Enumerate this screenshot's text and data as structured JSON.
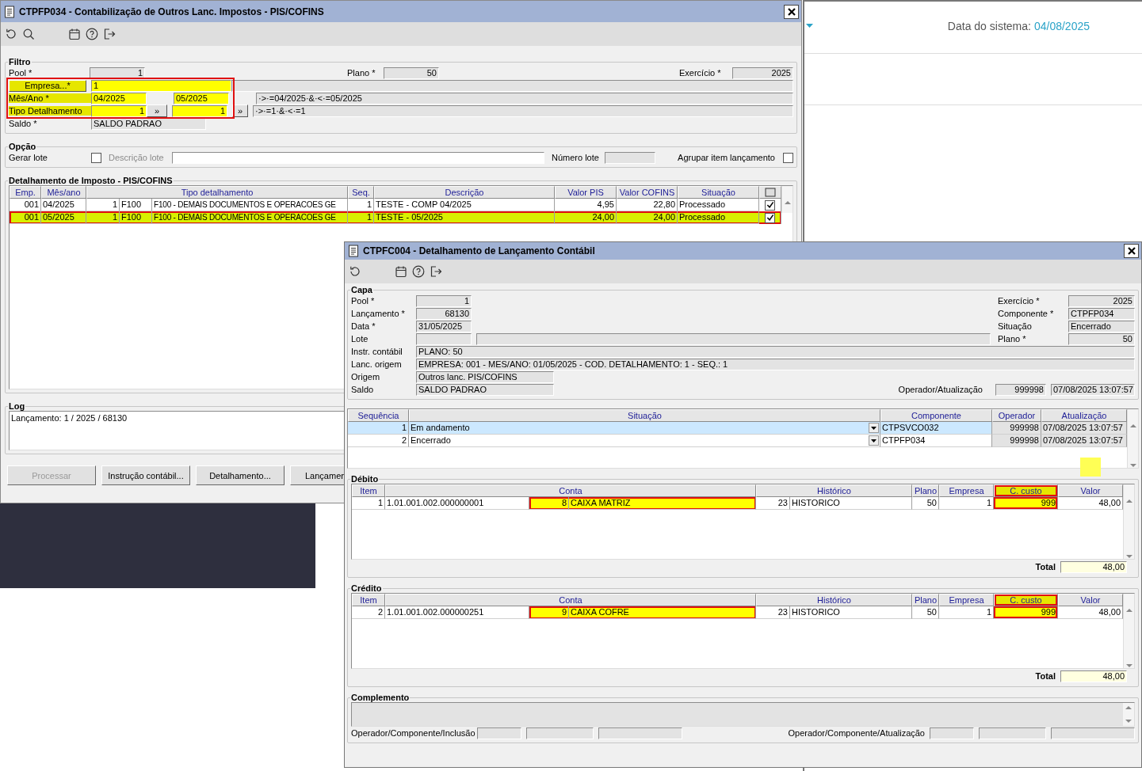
{
  "window1": {
    "title": "CTPFP034 - Contabilização de Outros Lanc. Impostos - PIS/COFINS",
    "filtro": {
      "title": "Filtro",
      "highlighted": true,
      "pool": {
        "label": "Pool *",
        "value": "1"
      },
      "plano": {
        "label": "Plano *",
        "value": "50"
      },
      "exercicio": {
        "label": "Exercício *",
        "value": "2025"
      },
      "empresa": {
        "label": "Empresa...*",
        "value": "1"
      },
      "mes_ano": {
        "label": "Mês/Ano *",
        "from": "04/2025",
        "to": "05/2025",
        "expression": "·>·=04/2025·&·<·=05/2025"
      },
      "tipo_detalhamento": {
        "label": "Tipo Detalhamento",
        "from": "1",
        "to": "1",
        "button": "»",
        "button_2": "»",
        "expression": "·>·=1·&·<·=1"
      },
      "saldo": {
        "label": "Saldo *",
        "value": "SALDO PADRAO"
      }
    },
    "opcao": {
      "title": "Opção",
      "gerar_lote": {
        "label": "Gerar lote",
        "checked": false
      },
      "descricao_lote": {
        "label": "Descrição lote",
        "disabled": true
      },
      "numero_lote": {
        "label": "Número lote"
      },
      "agrupar": {
        "label": "Agrupar item lançamento",
        "checked": false
      }
    },
    "detalhamento": {
      "title": "Detalhamento de Imposto - PIS/COFINS",
      "columns": [
        "Emp.",
        "Mês/ano",
        "Tipo detalhamento",
        "Seq.",
        "Descrição",
        "Valor PIS",
        "Valor COFINS",
        "Situação"
      ],
      "rows": [
        {
          "emp": "001",
          "mes_ano": "04/2025",
          "tipo_codigo": "1",
          "tipo": "F100",
          "tipo_descricao": "F100 - DEMAIS DOCUMENTOS E OPERACOES GE",
          "seq": "1",
          "descricao": "TESTE - COMP 04/2025",
          "valor_pis": "4,95",
          "valor_cofins": "22,80",
          "situacao": "Processado",
          "checked": true,
          "highlighted": false
        },
        {
          "emp": "001",
          "mes_ano": "05/2025",
          "tipo_codigo": "1",
          "tipo": "F100",
          "tipo_descricao": "F100 - DEMAIS DOCUMENTOS E OPERACOES GE",
          "seq": "1",
          "descricao": "TESTE - 05/2025",
          "valor_pis": "24,00",
          "valor_cofins": "24,00",
          "situacao": "Processado",
          "checked": true,
          "highlighted": true
        }
      ]
    },
    "log": {
      "title": "Log",
      "text": "Lançamento: 1 / 2025 / 68130"
    },
    "buttons": [
      {
        "label": "Processar",
        "disabled": true
      },
      {
        "label": "Instrução contábil...",
        "disabled": false
      },
      {
        "label": "Detalhamento...",
        "disabled": false
      },
      {
        "label": "Lançamen",
        "disabled": false
      }
    ]
  },
  "window2": {
    "title": "CTPFC004 - Detalhamento de Lançamento Contábil",
    "capa": {
      "title": "Capa",
      "pool": {
        "label": "Pool *",
        "value": "1"
      },
      "lancamento": {
        "label": "Lançamento *",
        "value": "68130"
      },
      "data": {
        "label": "Data *",
        "value": "31/05/2025"
      },
      "lote": {
        "label": "Lote"
      },
      "instr_contabil": {
        "label": "Instr. contábil",
        "value": "PLANO: 50"
      },
      "lanc_origem": {
        "label": "Lanc. origem",
        "value": "EMPRESA: 001 - MES/ANO: 01/05/2025 - COD. DETALHAMENTO: 1 - SEQ.: 1"
      },
      "origem": {
        "label": "Origem",
        "value": "Outros lanc. PIS/COFINS"
      },
      "saldo": {
        "label": "Saldo",
        "value": "SALDO PADRAO"
      },
      "exercicio": {
        "label": "Exercício *",
        "value": "2025"
      },
      "componente": {
        "label": "Componente *",
        "value": "CTPFP034"
      },
      "situacao": {
        "label": "Situação",
        "value": "Encerrado"
      },
      "plano": {
        "label": "Plano *",
        "value": "50"
      },
      "operador_atualizacao": {
        "label": "Operador/Atualização",
        "operador": "999998",
        "data": "07/08/2025 13:07:57"
      }
    },
    "sequencias": {
      "columns": [
        "Sequência",
        "Situação",
        "Componente",
        "Operador",
        "Atualização"
      ],
      "rows": [
        {
          "sequencia": "1",
          "situacao": "Em andamento",
          "componente": "CTPSVCO032",
          "operador": "999998",
          "atualizacao": "07/08/2025 13:07:57",
          "selected": true
        },
        {
          "sequencia": "2",
          "situacao": "Encerrado",
          "componente": "CTPFP034",
          "operador": "999998",
          "atualizacao": "07/08/2025 13:07:57",
          "selected": false
        }
      ]
    },
    "yellow_mark": true,
    "debito": {
      "title": "Débito",
      "columns": [
        {
          "label": "Item",
          "highlighted": false
        },
        {
          "label": "Conta",
          "highlighted": false
        },
        {
          "label": "Histórico",
          "highlighted": false
        },
        {
          "label": "Plano",
          "highlighted": false
        },
        {
          "label": "Empresa",
          "highlighted": false
        },
        {
          "label": "C. custo",
          "highlighted": true
        },
        {
          "label": "Valor",
          "highlighted": false
        }
      ],
      "rows": [
        {
          "item": "1",
          "conta": "1.01.001.002.000000001",
          "conta_codigo": "8",
          "conta_nome": "CAIXA MATRIZ",
          "historico_codigo": "23",
          "historico": "HISTORICO",
          "plano": "50",
          "empresa": "1",
          "c_custo": "999",
          "valor": "48,00",
          "conta_highlighted": true,
          "c_custo_highlighted": true
        }
      ],
      "total_label": "Total",
      "total": "48,00"
    },
    "credito": {
      "title": "Crédito",
      "columns": [
        {
          "label": "Item",
          "highlighted": false
        },
        {
          "label": "Conta",
          "highlighted": false
        },
        {
          "label": "Histórico",
          "highlighted": false
        },
        {
          "label": "Plano",
          "highlighted": false
        },
        {
          "label": "Empresa",
          "highlighted": false
        },
        {
          "label": "C. custo",
          "highlighted": true
        },
        {
          "label": "Valor",
          "highlighted": false
        }
      ],
      "rows": [
        {
          "item": "2",
          "conta": "1.01.001.002.000000251",
          "conta_codigo": "9",
          "conta_nome": "CAIXA COFRE",
          "historico_codigo": "23",
          "historico": "HISTORICO",
          "plano": "50",
          "empresa": "1",
          "c_custo": "999",
          "valor": "48,00",
          "conta_highlighted": true,
          "c_custo_highlighted": true
        }
      ],
      "total_label": "Total",
      "total": "48,00"
    },
    "complemento": {
      "title": "Complemento",
      "inclusao_label": "Operador/Componente/Inclusão",
      "atualizacao_label": "Operador/Componente/Atualização"
    }
  },
  "system": {
    "label": "Data do sistema:",
    "date": "04/08/2025"
  }
}
